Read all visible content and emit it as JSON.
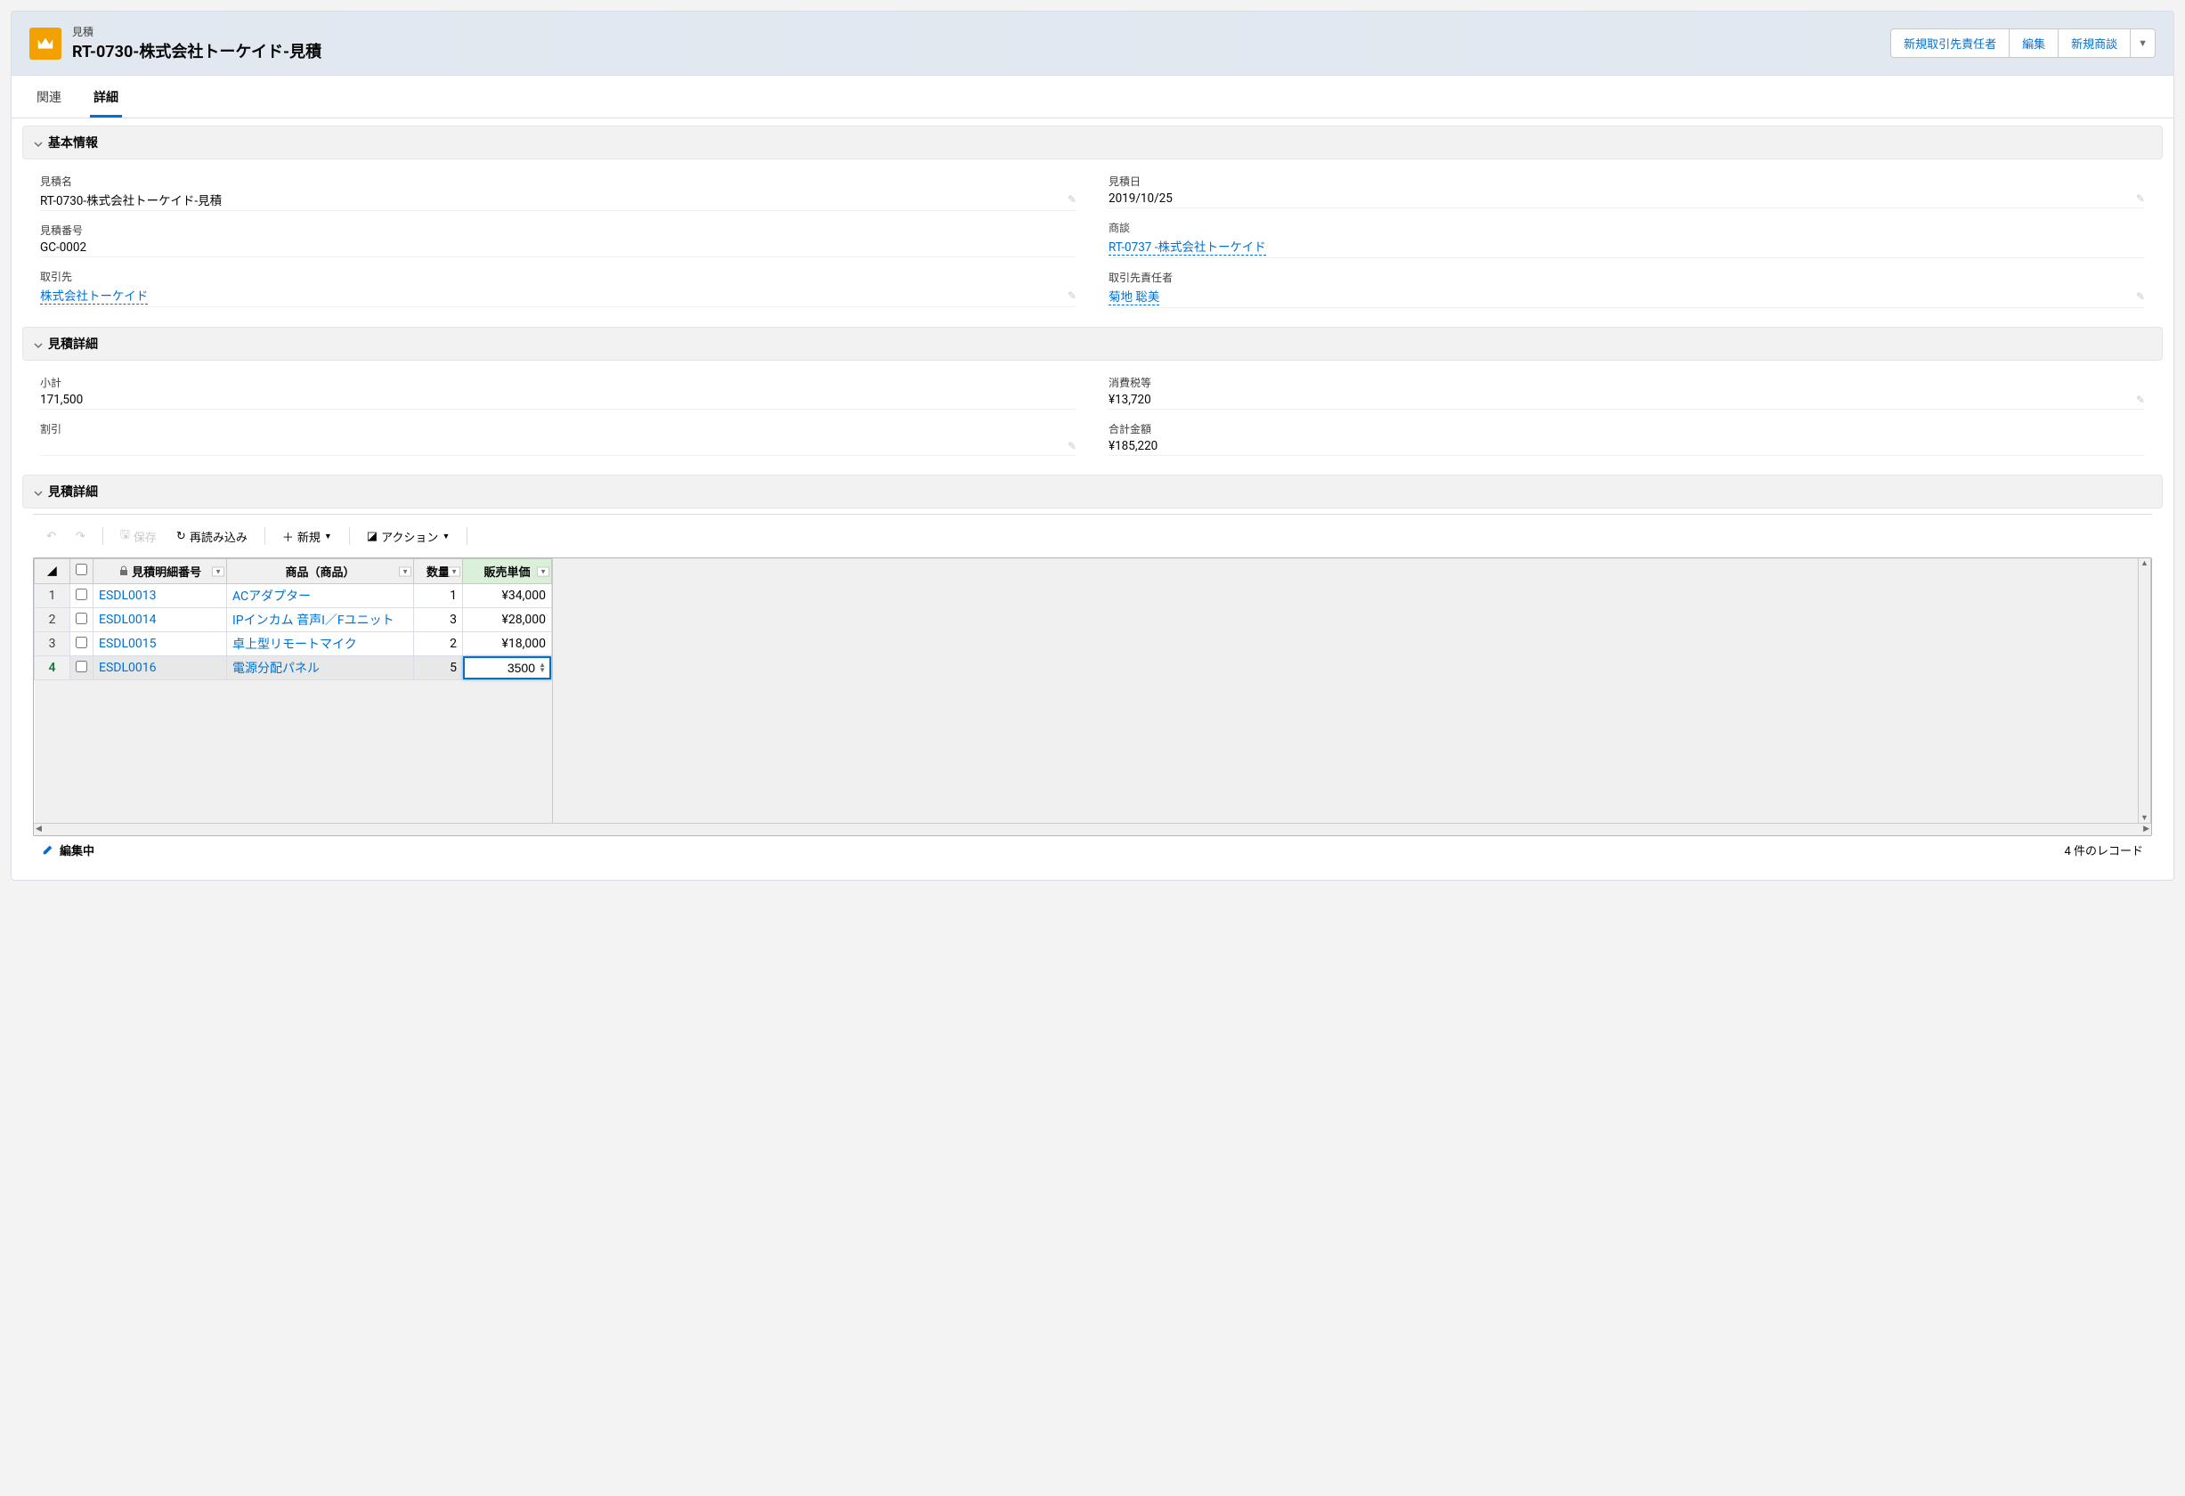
{
  "header": {
    "object_label": "見積",
    "record_title": "RT-0730-株式会社トーケイド-見積",
    "actions": {
      "new_contact": "新規取引先責任者",
      "edit": "編集",
      "new_opportunity": "新規商談"
    }
  },
  "tabs": {
    "related": "関連",
    "detail": "詳細"
  },
  "sections": {
    "basic": {
      "title": "基本情報",
      "fields": {
        "name_label": "見積名",
        "name_value": "RT-0730-株式会社トーケイド-見積",
        "date_label": "見積日",
        "date_value": "2019/10/25",
        "number_label": "見積番号",
        "number_value": "GC-0002",
        "opportunity_label": "商談",
        "opportunity_value": "RT-0737 -株式会社トーケイド",
        "account_label": "取引先",
        "account_value": "株式会社トーケイド",
        "contact_label": "取引先責任者",
        "contact_value": "菊地 聡美"
      }
    },
    "totals": {
      "title": "見積詳細",
      "fields": {
        "subtotal_label": "小計",
        "subtotal_value": "171,500",
        "tax_label": "消費税等",
        "tax_value": "¥13,720",
        "discount_label": "割引",
        "discount_value": "",
        "grand_label": "合計金額",
        "grand_value": "¥185,220"
      }
    },
    "lines": {
      "title": "見積詳細"
    }
  },
  "toolbar": {
    "save": "保存",
    "reload": "再読み込み",
    "new": "新規",
    "action": "アクション"
  },
  "grid": {
    "columns": {
      "line_no": "見積明細番号",
      "product": "商品（商品）",
      "qty": "数量",
      "unit_price": "販売単価"
    },
    "rows": [
      {
        "num": "1",
        "code": "ESDL0013",
        "product": "ACアダプター",
        "qty": "1",
        "price": "¥34,000"
      },
      {
        "num": "2",
        "code": "ESDL0014",
        "product": "IPインカム 音声I／Fユニット",
        "qty": "3",
        "price": "¥28,000"
      },
      {
        "num": "3",
        "code": "ESDL0015",
        "product": "卓上型リモートマイク",
        "qty": "2",
        "price": "¥18,000"
      },
      {
        "num": "4",
        "code": "ESDL0016",
        "product": "電源分配パネル",
        "qty": "5",
        "price_editing": "3500"
      }
    ],
    "footer": {
      "editing": "編集中",
      "record_count": "4 件のレコード"
    }
  }
}
